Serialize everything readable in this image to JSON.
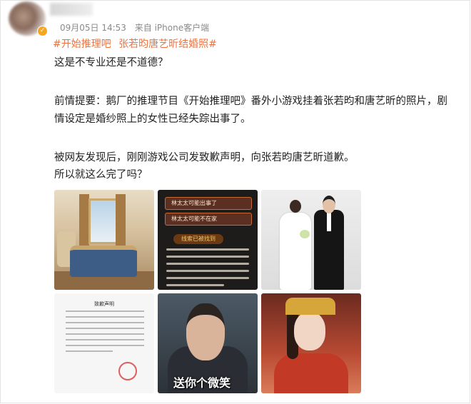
{
  "post": {
    "time": "09月05日 14:53",
    "source": "来自 iPhone客户端",
    "tags": [
      "#开始推理吧",
      "张若昀唐艺昕结婚照#"
    ],
    "paragraphs": [
      "这是不专业还是不道德？",
      "前情提要：鹅厂的推理节目《开始推理吧》番外小游戏挂着张若昀和唐艺昕的照片，剧",
      "情设定是婚纱照上的女性已经失踪出事了。",
      "被网友发现后，刚刚游戏公司发致歉声明，向张若昀唐艺昕道歉。",
      "所以就这么完了吗？"
    ]
  },
  "images": {
    "game_option_1": "林太太可能出事了",
    "game_option_2": "林太太可能不在家",
    "game_title": "线索已被找到",
    "document_title": "致歉声明",
    "meme_caption": "送你个微笑"
  },
  "colors": {
    "tag": "#eb7340",
    "meta": "#8a8a8a"
  }
}
